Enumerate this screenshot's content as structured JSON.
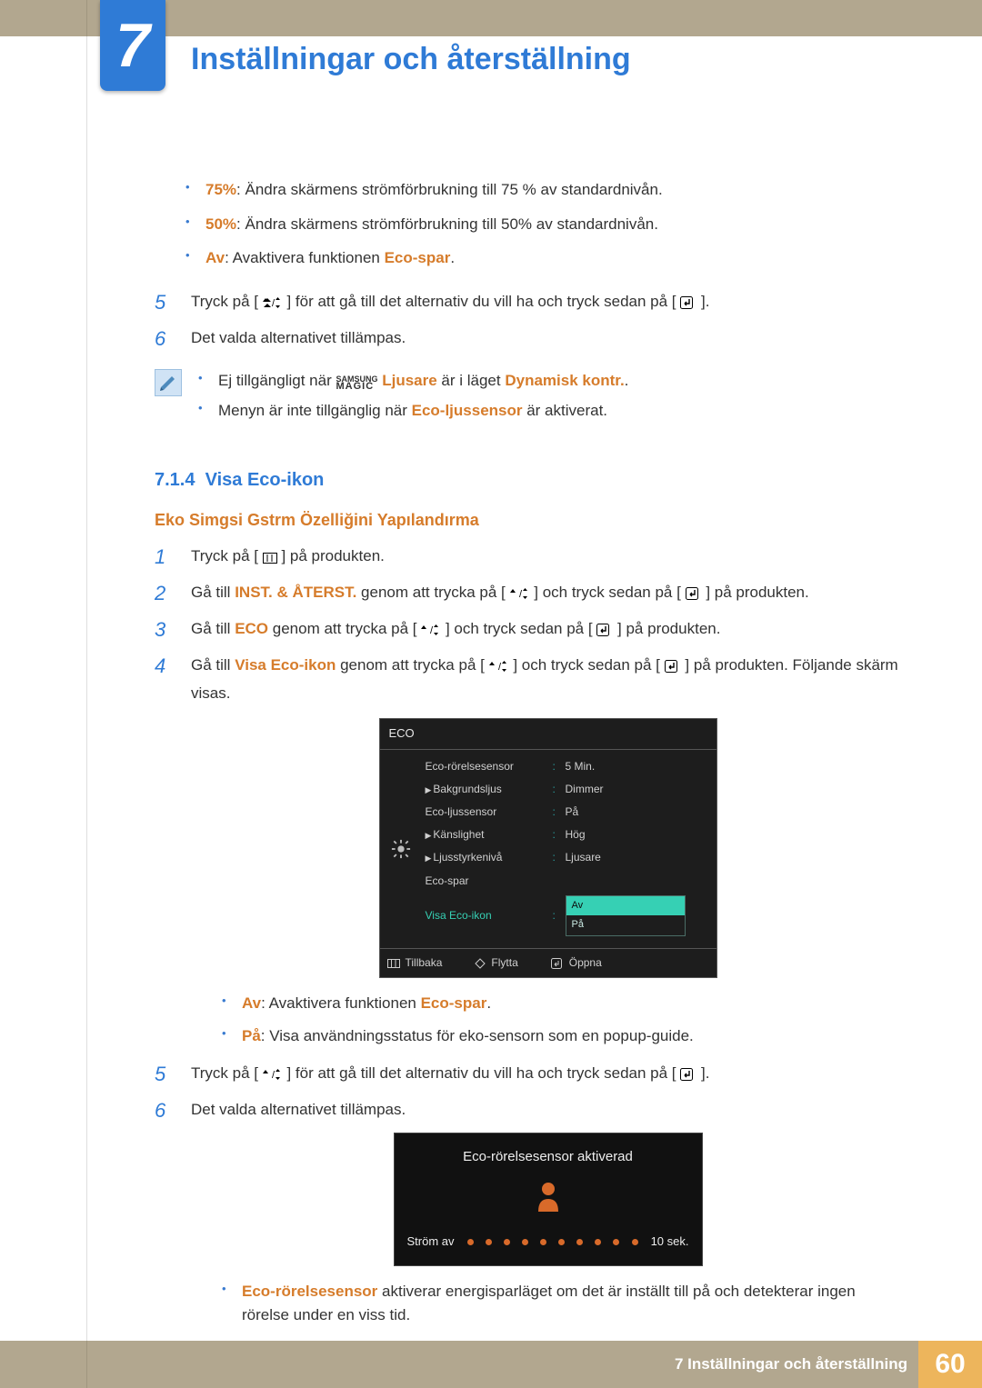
{
  "chapter": {
    "number": "7",
    "title": "Inställningar och återställning"
  },
  "top_bullets": [
    {
      "bold": "75%",
      "text": ": Ändra skärmens strömförbrukning till 75 % av standardnivån."
    },
    {
      "bold": "50%",
      "text": ": Ändra skärmens strömförbrukning till 50% av standardnivån."
    },
    {
      "bold": "Av",
      "text": ": Avaktivera funktionen ",
      "accent": "Eco-spar",
      "suffix": "."
    }
  ],
  "steps_a": {
    "s5_pre": "Tryck på [",
    "s5_mid": "] för att gå till det alternativ du vill ha och tryck sedan på [",
    "s5_post": "].",
    "s6": "Det valda alternativet tillämpas."
  },
  "notes": {
    "n1_pre": "Ej tillgängligt när ",
    "n1_mid": " Ljusare",
    "n1_mid2": " är i läget ",
    "n1_acc2": "Dynamisk kontr.",
    "n1_suffix": ".",
    "n2_pre": "Menyn är inte tillgänglig när ",
    "n2_acc": "Eco-ljussensor",
    "n2_suffix": " är aktiverat."
  },
  "magic_label": {
    "row1": "SAMSUNG",
    "row2": "MAGIC"
  },
  "section": {
    "num": "7.1.4",
    "title": "Visa Eco-ikon"
  },
  "subheader": "Eko Simgsi Gstrm Özelliğini Yapılandırma",
  "steps_b": {
    "s1_pre": "Tryck på [ ",
    "s1_post": " ] på produkten.",
    "s2_pre": "Gå till ",
    "s2_acc": "INST. & ÅTERST.",
    "s2_mid": " genom att trycka på [",
    "s2_mid2": "] och tryck sedan på [",
    "s2_post": "] på produkten.",
    "s3_pre": "Gå till ",
    "s3_acc": "ECO",
    "s3_mid": " genom att trycka på [",
    "s3_mid2": "] och tryck sedan på [",
    "s3_post": "] på produkten.",
    "s4_pre": "Gå till ",
    "s4_acc": "Visa Eco-ikon",
    "s4_mid": " genom att trycka på [",
    "s4_mid2": "] och tryck sedan på [",
    "s4_post": "] på produkten. Följande skärm visas."
  },
  "osd": {
    "title": "ECO",
    "rows": [
      {
        "label": "Eco-rörelsesensor",
        "value": "5 Min."
      },
      {
        "label": "Bakgrundsljus",
        "value": "Dimmer",
        "tri": true
      },
      {
        "label": "Eco-ljussensor",
        "value": "På"
      },
      {
        "label": "Känslighet",
        "value": "Hög",
        "tri": true
      },
      {
        "label": "Ljusstyrkenivå",
        "value": "Ljusare",
        "tri": true
      },
      {
        "label": "Eco-spar",
        "value": ""
      },
      {
        "label": "Visa Eco-ikon",
        "value": "",
        "selected": true
      }
    ],
    "dropdown": {
      "items": [
        "Av",
        "På"
      ],
      "highlight_index": 0
    },
    "footer": {
      "back": "Tillbaka",
      "move": "Flytta",
      "open": "Öppna"
    }
  },
  "post_osd_bullets": [
    {
      "bold": "Av",
      "text": ": Avaktivera funktionen ",
      "accent": "Eco-spar",
      "suffix": "."
    },
    {
      "bold": "På",
      "text": ": Visa användningsstatus för eko-sensorn som en popup-guide."
    }
  ],
  "steps_c": {
    "s5_pre": "Tryck på [",
    "s5_mid": "] för att gå till det alternativ du vill ha och tryck sedan på [",
    "s5_post": "].",
    "s6": "Det valda alternativet tillämpas."
  },
  "popup": {
    "title": "Eco-rörelsesensor aktiverad",
    "left": "Ström av",
    "right": "10 sek."
  },
  "final_bullet": {
    "acc": "Eco-rörelsesensor",
    "text": " aktiverar energisparläget om det är inställt till på och detekterar ingen rörelse under en viss tid."
  },
  "footer": {
    "text": "7 Inställningar och återställning",
    "page": "60"
  }
}
